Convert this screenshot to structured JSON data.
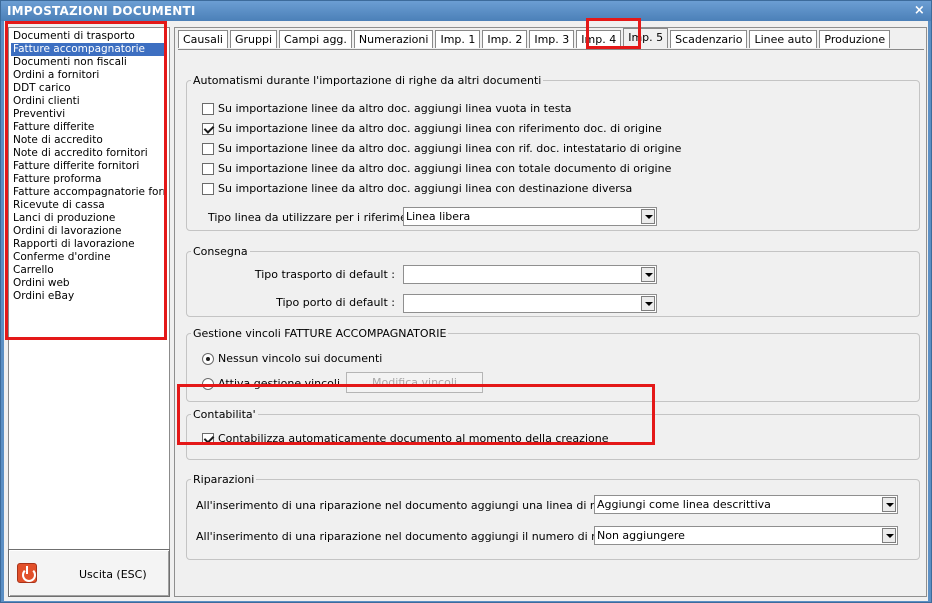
{
  "window": {
    "title": "IMPOSTAZIONI DOCUMENTI",
    "close_glyph": "×"
  },
  "doc_list": {
    "items": [
      "Documenti di trasporto",
      "Fatture accompagnatorie",
      "Documenti non fiscali",
      "Ordini a fornitori",
      "DDT carico",
      "Ordini clienti",
      "Preventivi",
      "Fatture differite",
      "Note di accredito",
      "Note di accredito fornitori",
      "Fatture differite fornitori",
      "Fatture proforma",
      "Fatture accompagnatorie fornitori",
      "Ricevute di cassa",
      "Lanci di produzione",
      "Ordini di lavorazione",
      "Rapporti di lavorazione",
      "Conferme d'ordine",
      "Carrello",
      "Ordini web",
      "Ordini eBay"
    ],
    "selected": "Fatture accompagnatorie"
  },
  "exit_button": {
    "label": "Uscita (ESC)",
    "icon": "power-icon"
  },
  "tabs": [
    "Causali",
    "Gruppi",
    "Campi agg.",
    "Numerazioni",
    "Imp. 1",
    "Imp. 2",
    "Imp. 3",
    "Imp. 4",
    "Imp. 5",
    "Scadenzario",
    "Linee auto",
    "Produzione"
  ],
  "active_tab": "Imp. 5",
  "automatismi": {
    "legend": "Automatismi durante l'importazione di righe da altri documenti",
    "options": [
      {
        "label": "Su importazione linee da altro doc. aggiungi linea vuota in testa",
        "checked": false
      },
      {
        "label": "Su importazione linee da altro doc. aggiungi linea con riferimento doc. di origine",
        "checked": true
      },
      {
        "label": "Su importazione linee da altro doc. aggiungi linea con rif. doc. intestatario di origine",
        "checked": false
      },
      {
        "label": "Su importazione linee da altro doc. aggiungi linea con totale documento di origine",
        "checked": false
      },
      {
        "label": "Su importazione linee da altro doc. aggiungi linea con destinazione diversa",
        "checked": false
      }
    ],
    "tipo_linea_label": "Tipo linea da utilizzare per i riferimenti :",
    "tipo_linea_value": "Linea libera"
  },
  "consegna": {
    "legend": "Consegna",
    "trasporto_label": "Tipo trasporto di default :",
    "trasporto_value": "",
    "porto_label": "Tipo porto di default :",
    "porto_value": ""
  },
  "vincoli": {
    "legend": "Gestione vincoli FATTURE ACCOMPAGNATORIE",
    "option_none": "Nessun vincolo sui documenti",
    "option_active": "Attiva gestione vincoli",
    "selected": "none",
    "button_label": "Modifica vincoli"
  },
  "contabilita": {
    "legend": "Contabilita'",
    "option": "Contabilizza automaticamente documento al momento della creazione",
    "checked": true
  },
  "riparazioni": {
    "legend": "Riparazioni",
    "riferimento_label": "All'inserimento di una riparazione nel documento aggiungi una linea di riferimento :",
    "riferimento_value": "Aggiungi come linea descrittiva",
    "matricola_label": "All'inserimento di una riparazione nel documento aggiungi il numero di matricola :",
    "matricola_value": "Non aggiungere"
  },
  "colors": {
    "titlebar": "#5b8fc4",
    "selection": "#3d6fc1",
    "highlight_box": "#e41818"
  }
}
